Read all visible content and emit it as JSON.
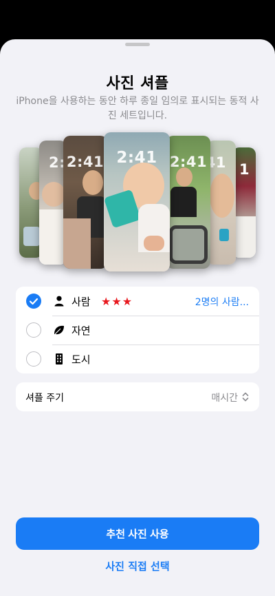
{
  "title": "사진 셔플",
  "subtitle": "iPhone을 사용하는 동안 하루 종일 임의로 표시되는 동적 사진 세트입니다.",
  "preview_clock": "2:41",
  "options": [
    {
      "label": "사람",
      "rating": "★★★",
      "detail": "2명의 사람...",
      "selected": true,
      "icon": "person-icon"
    },
    {
      "label": "자연",
      "selected": false,
      "icon": "leaf-icon"
    },
    {
      "label": "도시",
      "selected": false,
      "icon": "building-icon"
    }
  ],
  "frequency": {
    "label": "셔플 주기",
    "value": "매시간"
  },
  "primary_button": "추천 사진 사용",
  "secondary_button": "사진 직접 선택",
  "colors": {
    "accent": "#1a7cf5",
    "stars": "#e8191f"
  }
}
